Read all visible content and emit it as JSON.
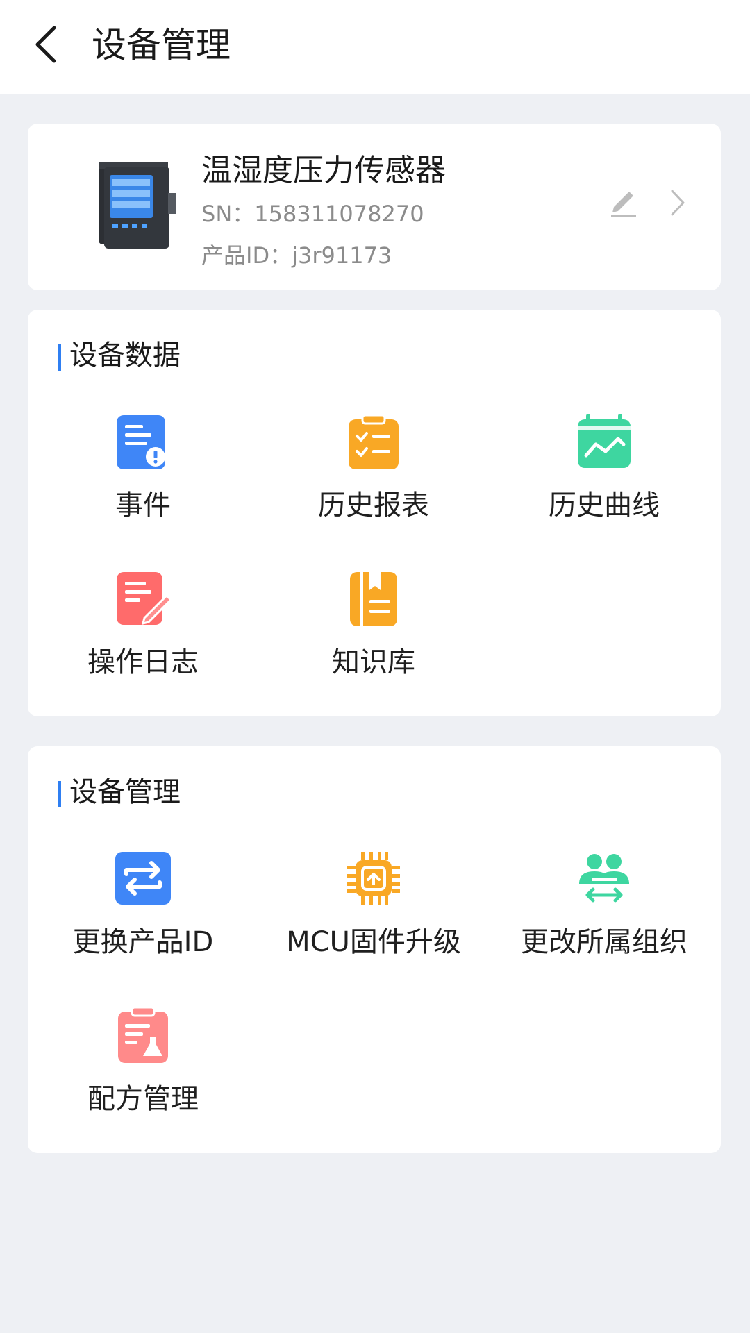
{
  "header": {
    "title": "设备管理"
  },
  "device": {
    "name": "温湿度压力传感器",
    "sn": "SN：158311078270",
    "product_id": "产品ID：j3r91173"
  },
  "device_data": {
    "title": "设备数据",
    "items": [
      {
        "label": "事件",
        "icon": "event-icon",
        "color": "#3f86f7"
      },
      {
        "label": "历史报表",
        "icon": "report-icon",
        "color": "#f9a825"
      },
      {
        "label": "历史曲线",
        "icon": "curve-icon",
        "color": "#3ed6a0"
      },
      {
        "label": "操作日志",
        "icon": "log-icon",
        "color": "#ff6b6b"
      },
      {
        "label": "知识库",
        "icon": "knowledge-icon",
        "color": "#f9a825"
      }
    ]
  },
  "device_manage": {
    "title": "设备管理",
    "items": [
      {
        "label": "更换产品ID",
        "icon": "swap-icon",
        "color": "#3f86f7"
      },
      {
        "label": "MCU固件升级",
        "icon": "chip-icon",
        "color": "#f9a825"
      },
      {
        "label": "更改所属组织",
        "icon": "group-icon",
        "color": "#3ed6a0"
      },
      {
        "label": "配方管理",
        "icon": "recipe-icon",
        "color": "#ff8a8a"
      }
    ]
  },
  "colors": {
    "accent": "#2f7ff2",
    "background": "#eef0f4"
  }
}
